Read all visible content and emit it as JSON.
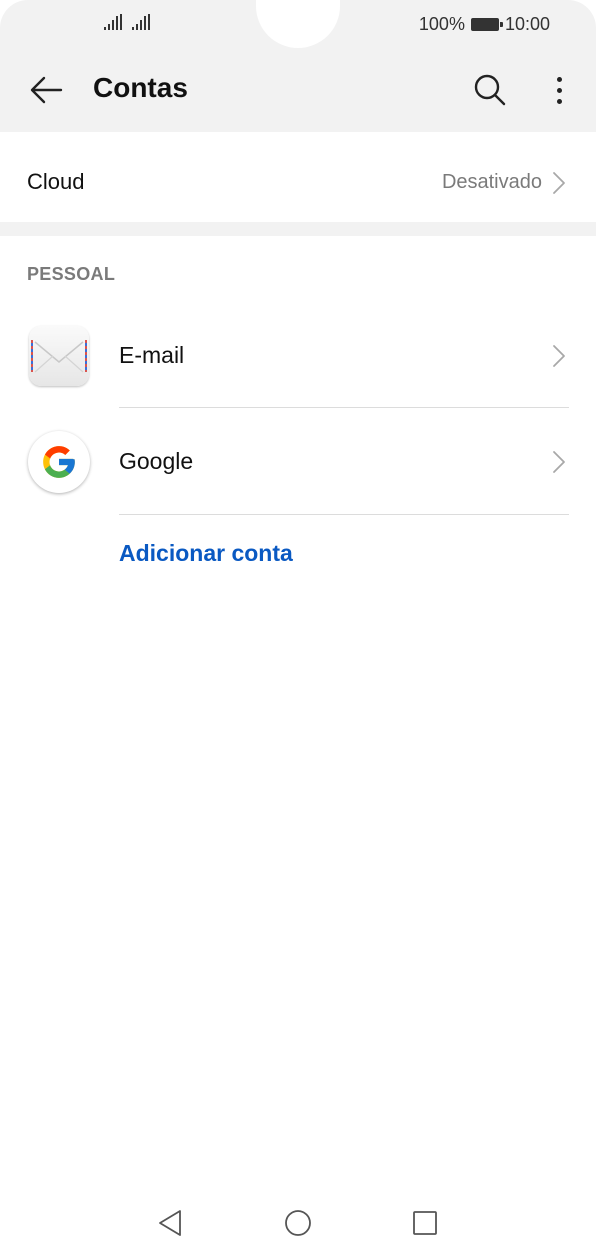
{
  "status_bar": {
    "battery_percent": "100%",
    "time": "10:00"
  },
  "toolbar": {
    "title": "Contas",
    "back_icon": "arrow-left-icon",
    "search_icon": "search-icon",
    "more_icon": "more-vertical-icon"
  },
  "cloud": {
    "label": "Cloud",
    "value": "Desativado"
  },
  "personal": {
    "header": "PESSOAL",
    "items": [
      {
        "label": "E-mail",
        "icon": "email-icon"
      },
      {
        "label": "Google",
        "icon": "google-icon"
      }
    ],
    "add_account": "Adicionar conta"
  },
  "colors": {
    "accent": "#0a59c2",
    "background_gray": "#f2f2f2",
    "secondary_text": "#7a7a7a"
  },
  "nav_bar": {
    "back_icon": "nav-back-icon",
    "home_icon": "nav-home-icon",
    "recent_icon": "nav-recent-icon"
  }
}
